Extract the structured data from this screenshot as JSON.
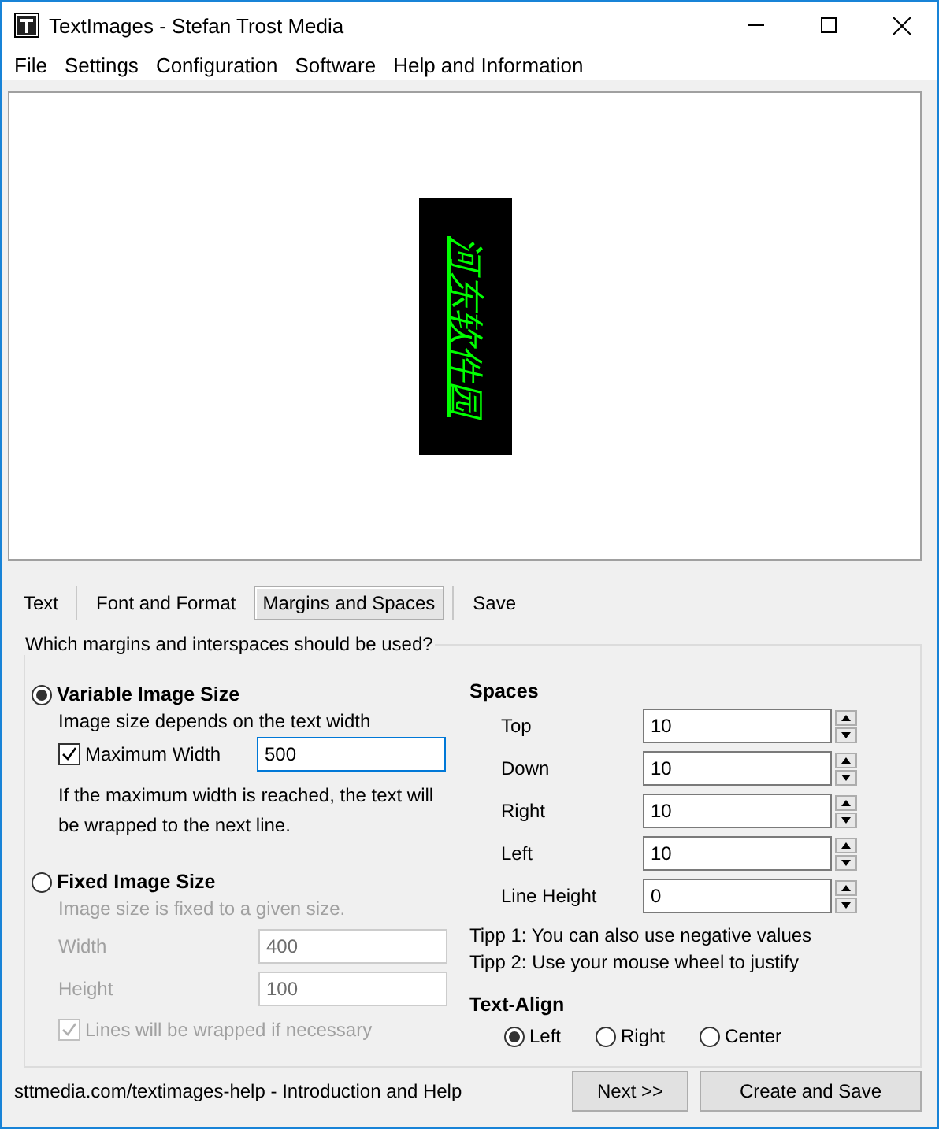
{
  "window": {
    "title": "TextImages - Stefan Trost Media"
  },
  "menu": [
    "File",
    "Settings",
    "Configuration",
    "Software",
    "Help and Information"
  ],
  "preview": {
    "text": "河东软件园"
  },
  "tabs": [
    {
      "label": "Text",
      "selected": false
    },
    {
      "label": "Font and Format",
      "selected": false
    },
    {
      "label": "Margins and Spaces",
      "selected": true
    },
    {
      "label": "Save",
      "selected": false
    }
  ],
  "group": {
    "title": "Which margins and interspaces should be used?"
  },
  "variable_size": {
    "label": "Variable Image Size",
    "selected": true,
    "description": "Image size depends on the text width",
    "max_width": {
      "label": "Maximum Width",
      "checked": true,
      "value": "500"
    },
    "note": "If the maximum width is reached, the text will be wrapped to the next line."
  },
  "fixed_size": {
    "label": "Fixed Image Size",
    "selected": false,
    "disabled": true,
    "description": "Image size is fixed to a given size.",
    "fields": [
      {
        "label": "Width",
        "value": "400"
      },
      {
        "label": "Height",
        "value": "100"
      }
    ],
    "wrap": {
      "label": "Lines will be wrapped if necessary",
      "checked": true
    }
  },
  "spaces": {
    "title": "Spaces",
    "fields": [
      {
        "label": "Top",
        "value": "10"
      },
      {
        "label": "Down",
        "value": "10"
      },
      {
        "label": "Right",
        "value": "10"
      },
      {
        "label": "Left",
        "value": "10"
      },
      {
        "label": "Line Height",
        "value": "0"
      }
    ],
    "tips": [
      "Tipp 1: You can also use negative values",
      "Tipp 2: Use your mouse wheel to justify"
    ]
  },
  "text_align": {
    "title": "Text-Align",
    "options": [
      {
        "label": "Left",
        "selected": true
      },
      {
        "label": "Right",
        "selected": false
      },
      {
        "label": "Center",
        "selected": false
      }
    ]
  },
  "help_link": "sttmedia.com/textimages-help - Introduction and Help",
  "buttons": [
    "Next >>",
    "Create and Save"
  ]
}
